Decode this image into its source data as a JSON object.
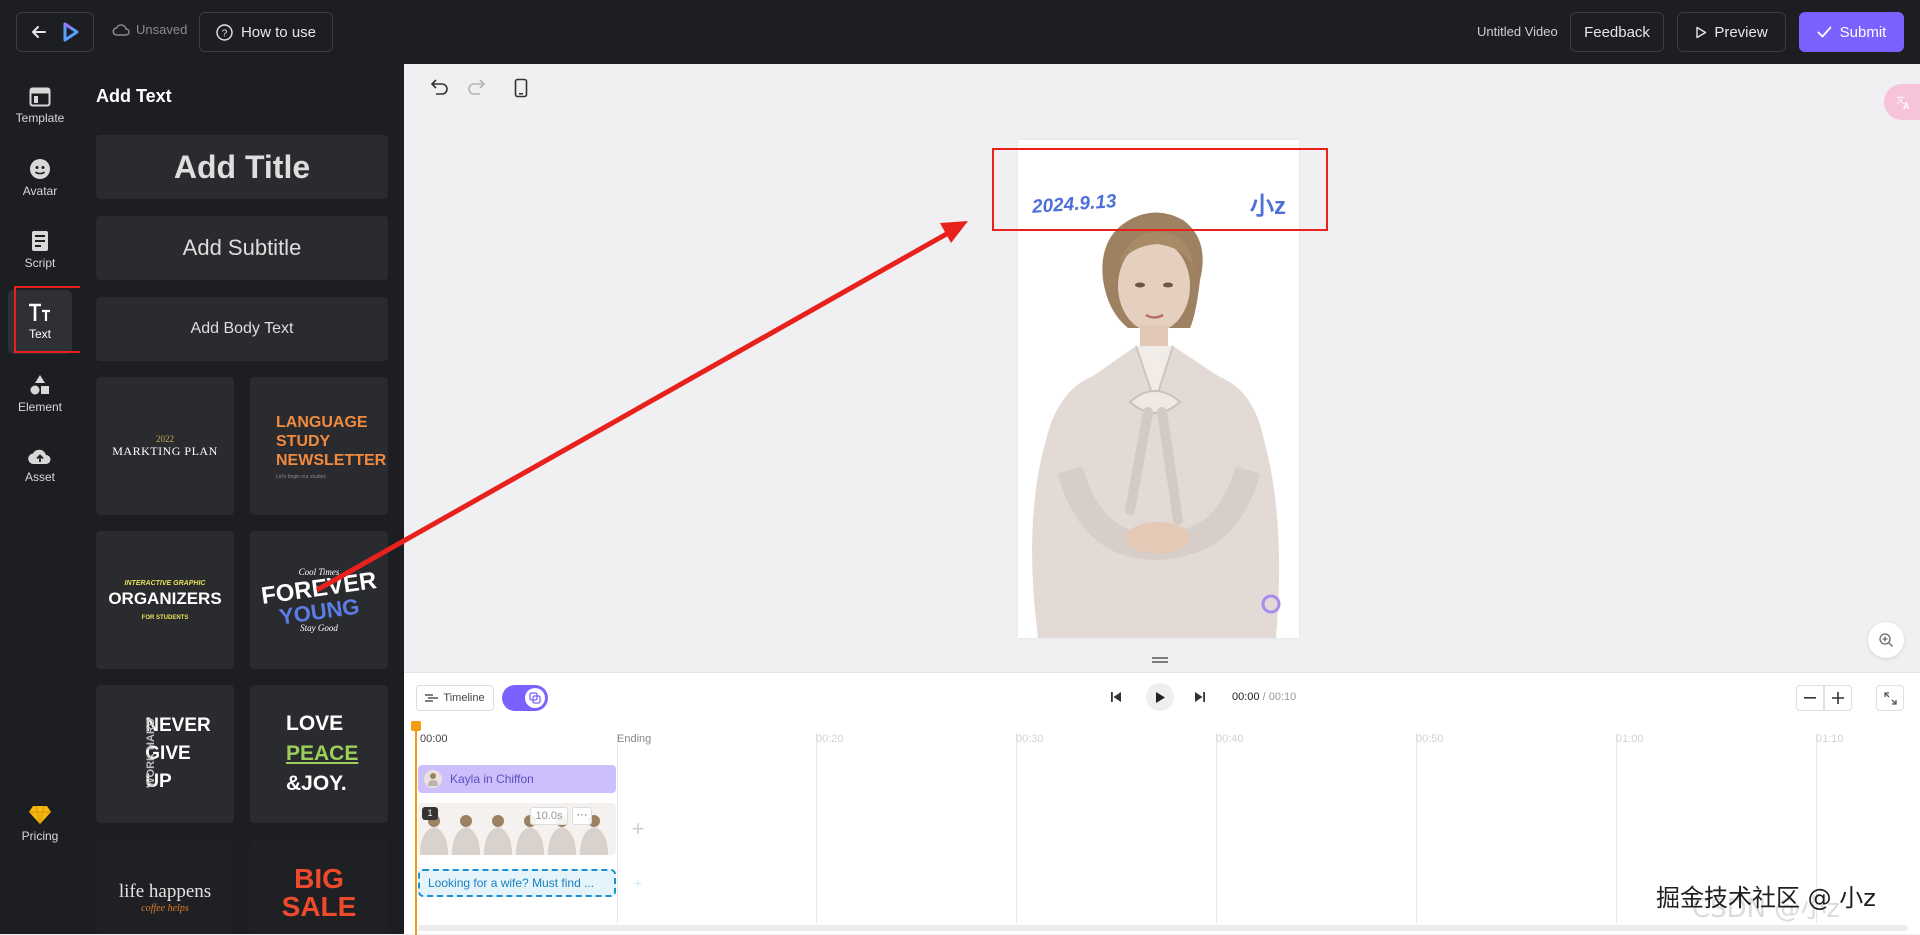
{
  "topbar": {
    "unsaved_label": "Unsaved",
    "how_to_use_label": "How to use",
    "video_title": "Untitled Video",
    "feedback_label": "Feedback",
    "preview_label": "Preview",
    "submit_label": "Submit"
  },
  "sidebar": {
    "items": [
      {
        "label": "Template",
        "icon": "layout-icon"
      },
      {
        "label": "Avatar",
        "icon": "avatar-icon"
      },
      {
        "label": "Script",
        "icon": "script-icon"
      },
      {
        "label": "Text",
        "icon": "text-icon"
      },
      {
        "label": "Element",
        "icon": "shapes-icon"
      },
      {
        "label": "Asset",
        "icon": "cloud-upload-icon"
      }
    ],
    "pricing_label": "Pricing"
  },
  "panel": {
    "title": "Add Text",
    "add_title": "Add Title",
    "add_subtitle": "Add Subtitle",
    "add_body": "Add Body Text",
    "templates": [
      {
        "line1": "2022",
        "line2": "MARKTING PLAN"
      },
      {
        "line1": "LANGUAGE",
        "line2": "STUDY",
        "line3": "NEWSLETTER",
        "line4": "Let's begin our studies"
      },
      {
        "line1": "INTERACTIVE GRAPHIC",
        "line2": "ORGANIZERS",
        "line3": "FOR STUDENTS"
      },
      {
        "line1": "Cool Times",
        "line2": "FOREVER",
        "line3": "YOUNG",
        "line4": "Stay Good"
      },
      {
        "side": "WORK HARD",
        "line1": "NEVER",
        "line2": "GIVE",
        "line3": "UP"
      },
      {
        "line1": "LOVE",
        "line2": "PEACE",
        "line3": "&JOY."
      },
      {
        "line1": "life happens",
        "line2": "coffee helps"
      },
      {
        "line1": "BIG",
        "line2": "SALE"
      }
    ]
  },
  "stage": {
    "date_text": "2024.9.13",
    "author_text": "小z"
  },
  "timeline": {
    "timeline_label": "Timeline",
    "current_time": "00:00",
    "total_time": "/ 00:10",
    "ticks": [
      "00:00",
      "Ending",
      "00:20",
      "00:30",
      "00:40",
      "00:50",
      "01:00",
      "01:10"
    ],
    "avatar_track_label": "Kayla in Chiffon",
    "scene_number": "1",
    "scene_duration": "10.0s",
    "scene_more": "···",
    "script_text": "Looking for a wife? Must find ...",
    "add_plus": "+"
  },
  "watermark": "掘金技术社区 @ 小z",
  "watermark_faint": "CSDN @小z",
  "colors": {
    "accent": "#7b61ff",
    "annotation": "#e8211c",
    "dark_bg": "#1d1e21"
  }
}
